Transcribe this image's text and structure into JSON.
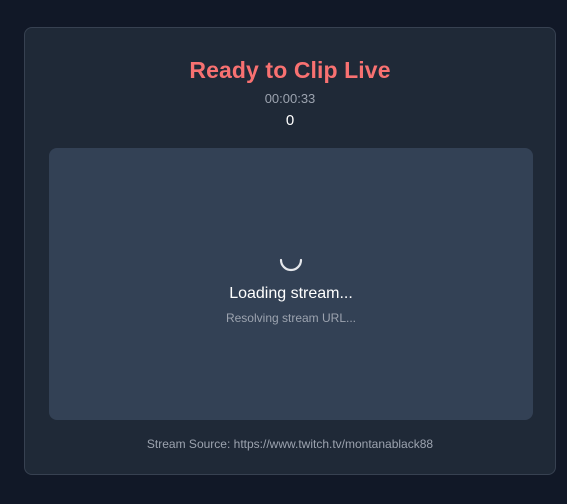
{
  "header": {
    "title": "Ready to Clip Live",
    "timer": "00:00:33",
    "count": "0"
  },
  "player": {
    "loading_title": "Loading stream...",
    "loading_subtitle": "Resolving stream URL..."
  },
  "footer": {
    "source_label": "Stream Source:",
    "source_url": "https://www.twitch.tv/montanablack88"
  },
  "colors": {
    "background": "#111827",
    "panel": "#1f2937",
    "player": "#334155",
    "title": "#f87171",
    "muted_text": "#9ca3af"
  }
}
